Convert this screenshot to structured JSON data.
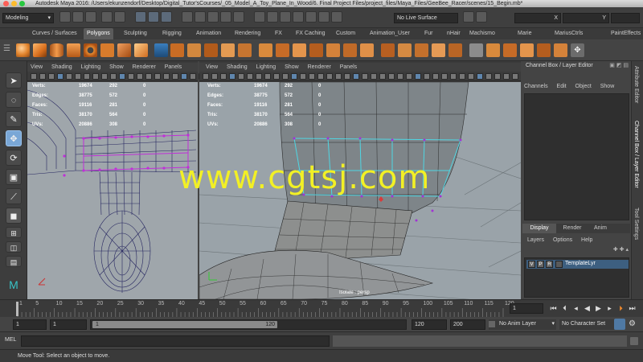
{
  "title_bar": {
    "text": "Autodesk Maya 2016: /Users/ekunzendorf/Desktop/Digital_Tutor'sCourses/_05_Model_A_Toy_Plane_In_Wood/6. Final Project Files/project_files/Maya_Files/GeeBee_Racer/scenes/15_Begin.mb*"
  },
  "status_line": {
    "menu_set": "Modeling",
    "live_surface": "No Live Surface",
    "x_field": "X",
    "y_field": "Y"
  },
  "shelf_tabs": [
    "Curves / Surfaces",
    "Polygons",
    "Sculpting",
    "Rigging",
    "Animation",
    "Rendering",
    "FX",
    "FX Caching",
    "Custom",
    "Animation_User",
    "Fur",
    "nHair",
    "Machismo",
    "Marie",
    "MariusCtrls",
    "PaintEffects",
    "Po"
  ],
  "active_shelf_tab": "Polygons",
  "panel_menu": [
    "View",
    "Shading",
    "Lighting",
    "Show",
    "Renderer",
    "Panels"
  ],
  "hud": {
    "rows": [
      {
        "label": "Verts:",
        "total": "19674",
        "selected": "292",
        "extra": "0"
      },
      {
        "label": "Edges:",
        "total": "38775",
        "selected": "572",
        "extra": "0"
      },
      {
        "label": "Faces:",
        "total": "19116",
        "selected": "281",
        "extra": "0"
      },
      {
        "label": "Tris:",
        "total": "38170",
        "selected": "564",
        "extra": "0"
      },
      {
        "label": "UVs:",
        "total": "20886",
        "selected": "308",
        "extra": "0"
      }
    ]
  },
  "viewport_right": {
    "camera_label": "Isolate : persp"
  },
  "channel_box": {
    "header": "Channel Box / Layer Editor",
    "menu": [
      "Channels",
      "Edit",
      "Object",
      "Show"
    ],
    "layer_tabs": [
      "Display",
      "Render",
      "Anim"
    ],
    "layer_menu": [
      "Layers",
      "Options",
      "Help"
    ],
    "layer": {
      "v": "V",
      "p": "P",
      "r": "R",
      "name": "TemplateLyr"
    },
    "side_tabs": [
      "Attribute Editor",
      "Channel Box / Layer Editor",
      "Tool Settings"
    ]
  },
  "timeline": {
    "ticks": [
      "1",
      "5",
      "10",
      "15",
      "20",
      "25",
      "30",
      "35",
      "40",
      "45",
      "50",
      "55",
      "60",
      "65",
      "70",
      "75",
      "80",
      "85",
      "90",
      "95",
      "100",
      "105",
      "110",
      "115",
      "120"
    ],
    "current_frame": "1"
  },
  "range_slider": {
    "start": "1",
    "playback_start": "1",
    "handle_start": "1",
    "handle_end": "120",
    "playback_end": "120",
    "end": "200",
    "anim_layer": "No Anim Layer",
    "character_set": "No Character Set"
  },
  "command_line": {
    "label": "MEL"
  },
  "help_line": {
    "text": "Move Tool: Select an object to move."
  },
  "watermark": "www.cgtsj.com"
}
